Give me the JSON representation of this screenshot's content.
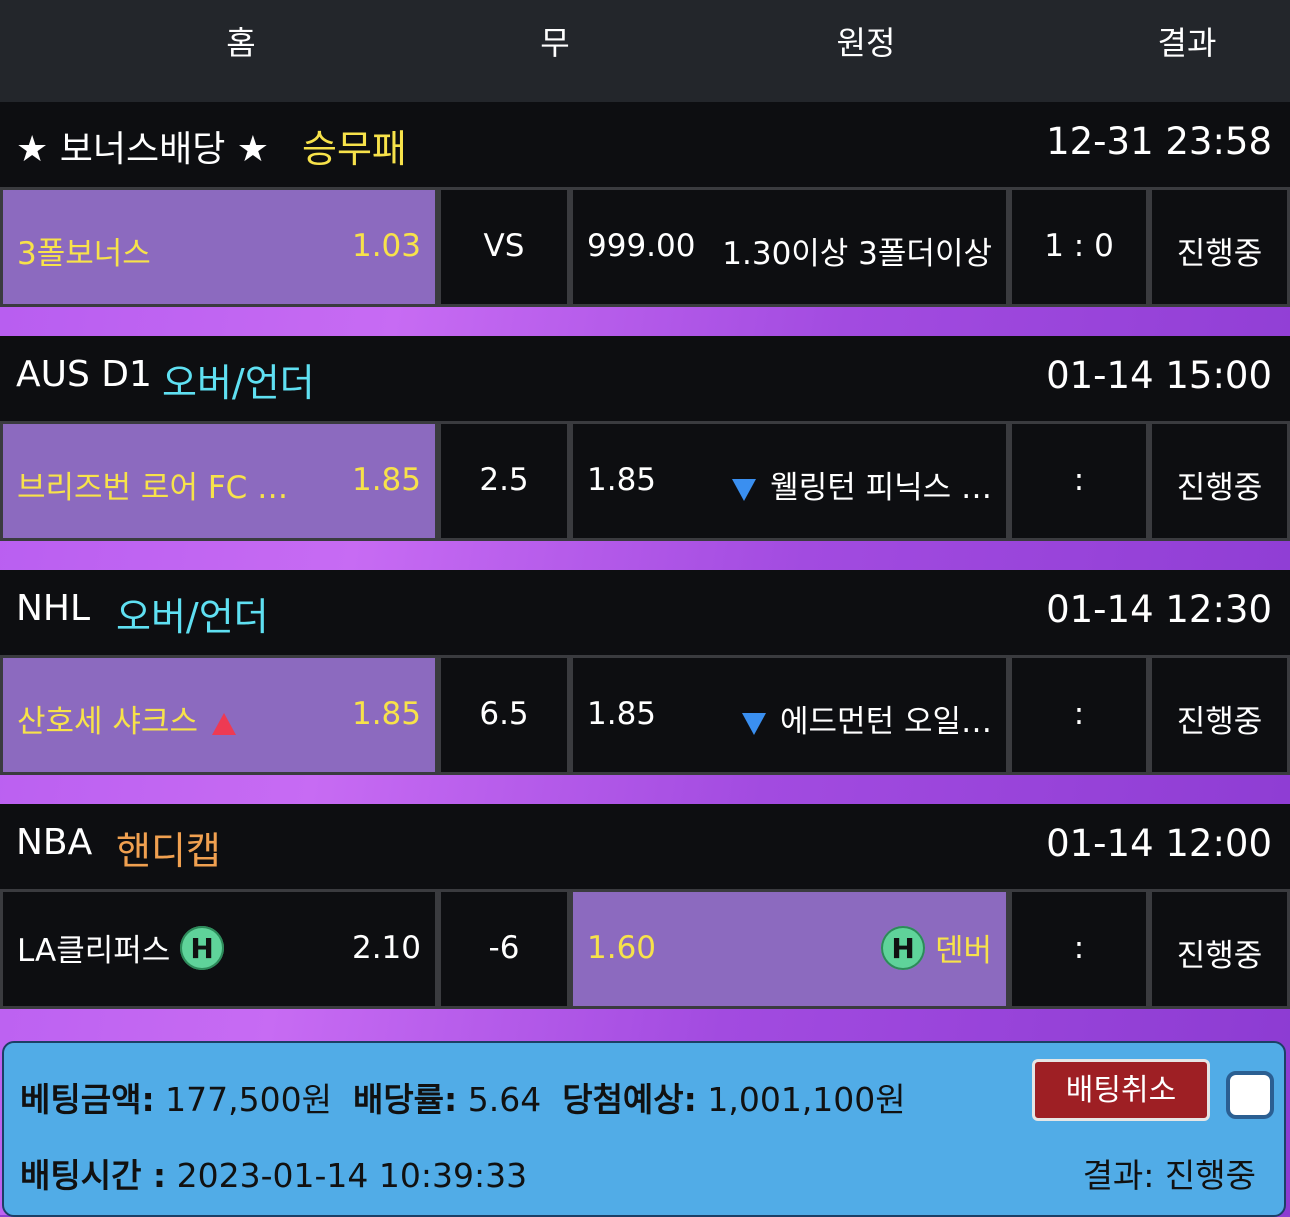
{
  "header": {
    "home": "홈",
    "draw": "무",
    "away": "원정",
    "result": "결과"
  },
  "colors": {
    "selected_cell": "#8c6abf",
    "market_yellow": "#f7e24a",
    "market_cyan": "#5fe0f2",
    "market_orange": "#f0a050",
    "panel_bg": "#51ace7",
    "cancel_btn": "#9e1f24"
  },
  "bets": [
    {
      "league": "★ 보너스배당 ★",
      "market": "승무패",
      "time": "12-31 23:58",
      "home_team": "3폴보너스",
      "home_odds": "1.03",
      "handicap": "VS",
      "away_odds": "999.00",
      "away_team": "1.30이상 3폴더이상",
      "score": "1 : 0",
      "status": "진행중"
    },
    {
      "league": "AUS D1",
      "market": "오버/언더",
      "time": "01-14 15:00",
      "home_team": "브리즈번 로어 FC …",
      "home_odds": "1.85",
      "handicap": "2.5",
      "away_odds": "1.85",
      "away_team": "웰링턴 피닉스 …",
      "score": ":",
      "status": "진행중"
    },
    {
      "league": "NHL",
      "market": "오버/언더",
      "time": "01-14 12:30",
      "home_team": "산호세 샤크스",
      "home_odds": "1.85",
      "handicap": "6.5",
      "away_odds": "1.85",
      "away_team": "에드먼턴 오일…",
      "score": ":",
      "status": "진행중"
    },
    {
      "league": "NBA",
      "market": "핸디캡",
      "time": "01-14 12:00",
      "home_team": "LA클리퍼스",
      "home_odds": "2.10",
      "handicap": "-6",
      "away_odds": "1.60",
      "away_team": "덴버",
      "score": ":",
      "status": "진행중",
      "badge": "H"
    }
  ],
  "summary": {
    "amount_label": "베팅금액:",
    "amount": "177,500원",
    "rate_label": "배당률:",
    "rate": "5.64",
    "expected_label": "당첨예상:",
    "expected": "1,001,100원",
    "time_label": "배팅시간 :",
    "time": "2023-01-14 10:39:33",
    "result_label": "결과:",
    "result": "진행중",
    "cancel_label": "배팅취소"
  }
}
